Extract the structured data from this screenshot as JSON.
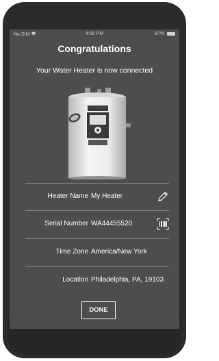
{
  "status_bar": {
    "carrier": "No SIM",
    "time": "4:56 PM",
    "battery": "87%"
  },
  "header": {
    "title": "Congratulations",
    "subtitle": "Your Water Heater is now connected"
  },
  "details": [
    {
      "label": "Heater Name",
      "value": "My Heater",
      "icon": "pencil-icon"
    },
    {
      "label": "Serial Number",
      "value": "WA44455520",
      "icon": "barcode-scan-icon"
    },
    {
      "label": "Time Zone",
      "value": "America/New York"
    },
    {
      "label": "Location",
      "value": "Philadelphia, PA, 19103"
    }
  ],
  "actions": {
    "done_label": "DONE"
  },
  "colors": {
    "screen_bg": "#4d4d4d",
    "frame": "#2b2b2b",
    "text": "#ffffff",
    "divider": "#8a8a8a"
  }
}
